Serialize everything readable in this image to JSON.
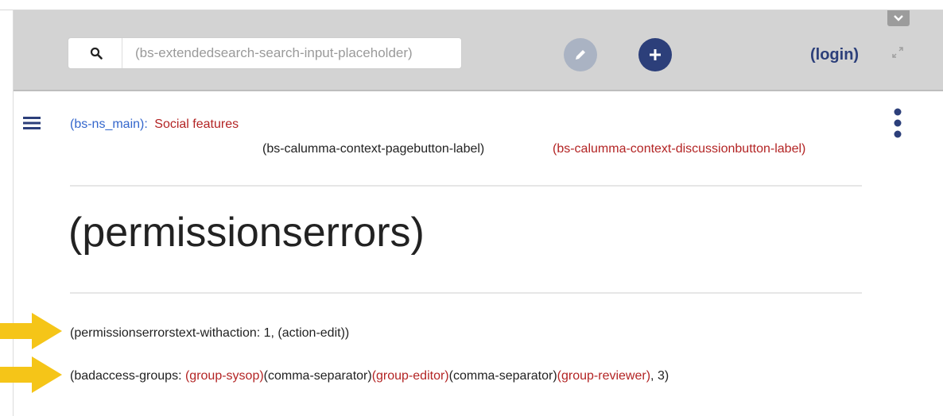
{
  "header": {
    "search": {
      "placeholder": "(bs-extendedsearch-search-input-placeholder)"
    },
    "login_label": "(login)",
    "colors": {
      "bar": "#d3d3d3",
      "accent": "#2c3f7a",
      "edit_button": "#aab3c3"
    }
  },
  "breadcrumb": {
    "namespace": "(bs-ns_main):",
    "page": "Social features"
  },
  "context_buttons": {
    "page": "(bs-calumma-context-pagebutton-label)",
    "discussion": "(bs-calumma-context-discussionbutton-label)"
  },
  "page_title": "(permissionserrors)",
  "messages": {
    "line1": "(permissionserrorstext-withaction: 1, (action-edit))",
    "line2": {
      "prefix": "(badaccess-groups: ",
      "group1": "(group-sysop)",
      "sep1": "(comma-separator)",
      "group2": "(group-editor)",
      "sep2": "(comma-separator)",
      "group3": "(group-reviewer)",
      "suffix": ", 3)"
    }
  },
  "icons": {
    "search": "search-icon",
    "edit": "pencil-icon",
    "add": "plus-icon",
    "collapse": "chevron-down-icon",
    "expand": "expand-icon",
    "menu": "hamburger-icon",
    "more": "kebab-icon",
    "pointer": "arrow-right-icon"
  }
}
